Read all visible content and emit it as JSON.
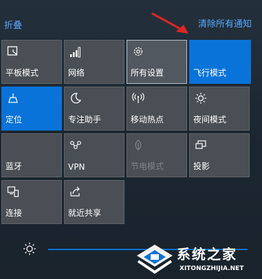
{
  "header": {
    "collapse_label": "折叠",
    "clear_all_label": "清除所有通知"
  },
  "tiles": [
    {
      "label": "平板模式",
      "icon": "tablet-mode-icon",
      "state": "off"
    },
    {
      "label": "网络",
      "icon": "network-signal-icon",
      "state": "off"
    },
    {
      "label": "所有设置",
      "icon": "gear-icon",
      "state": "off"
    },
    {
      "label": "飞行模式",
      "icon": "airplane-icon",
      "state": "on"
    },
    {
      "label": "定位",
      "icon": "location-icon",
      "state": "on"
    },
    {
      "label": "专注助手",
      "icon": "moon-icon",
      "state": "off"
    },
    {
      "label": "移动热点",
      "icon": "hotspot-icon",
      "state": "off"
    },
    {
      "label": "夜间模式",
      "icon": "night-light-icon",
      "state": "off"
    },
    {
      "label": "蓝牙",
      "icon": "bluetooth-icon",
      "state": "off"
    },
    {
      "label": "VPN",
      "icon": "vpn-icon",
      "state": "off"
    },
    {
      "label": "节电模式",
      "icon": "battery-saver-icon",
      "state": "disabled"
    },
    {
      "label": "投影",
      "icon": "project-icon",
      "state": "off"
    },
    {
      "label": "连接",
      "icon": "connect-icon",
      "state": "off"
    },
    {
      "label": "就近共享",
      "icon": "nearby-share-icon",
      "state": "off"
    }
  ],
  "brightness": {
    "icon": "brightness-icon",
    "level": 1.0
  },
  "watermark": {
    "text": "系统之家",
    "url": "XITONGZHIJIA.NET"
  },
  "colors": {
    "accent": "#0a73d9",
    "tile": "#4a4f55",
    "link": "#58a8ff",
    "annotation_arrow": "#e02424"
  }
}
